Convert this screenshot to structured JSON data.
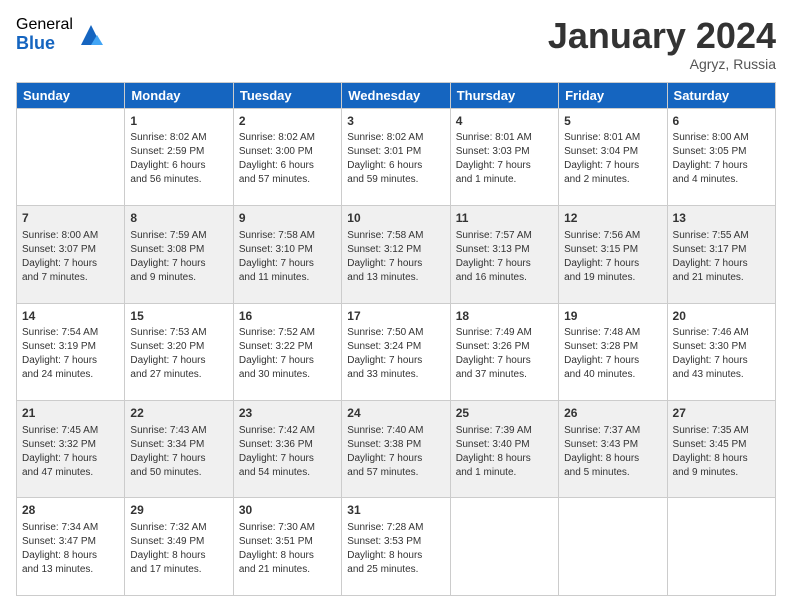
{
  "logo": {
    "general": "General",
    "blue": "Blue"
  },
  "title": "January 2024",
  "subtitle": "Agryz, Russia",
  "days_header": [
    "Sunday",
    "Monday",
    "Tuesday",
    "Wednesday",
    "Thursday",
    "Friday",
    "Saturday"
  ],
  "weeks": [
    [
      {
        "day": "",
        "info": ""
      },
      {
        "day": "1",
        "info": "Sunrise: 8:02 AM\nSunset: 2:59 PM\nDaylight: 6 hours\nand 56 minutes."
      },
      {
        "day": "2",
        "info": "Sunrise: 8:02 AM\nSunset: 3:00 PM\nDaylight: 6 hours\nand 57 minutes."
      },
      {
        "day": "3",
        "info": "Sunrise: 8:02 AM\nSunset: 3:01 PM\nDaylight: 6 hours\nand 59 minutes."
      },
      {
        "day": "4",
        "info": "Sunrise: 8:01 AM\nSunset: 3:03 PM\nDaylight: 7 hours\nand 1 minute."
      },
      {
        "day": "5",
        "info": "Sunrise: 8:01 AM\nSunset: 3:04 PM\nDaylight: 7 hours\nand 2 minutes."
      },
      {
        "day": "6",
        "info": "Sunrise: 8:00 AM\nSunset: 3:05 PM\nDaylight: 7 hours\nand 4 minutes."
      }
    ],
    [
      {
        "day": "7",
        "info": "Sunrise: 8:00 AM\nSunset: 3:07 PM\nDaylight: 7 hours\nand 7 minutes."
      },
      {
        "day": "8",
        "info": "Sunrise: 7:59 AM\nSunset: 3:08 PM\nDaylight: 7 hours\nand 9 minutes."
      },
      {
        "day": "9",
        "info": "Sunrise: 7:58 AM\nSunset: 3:10 PM\nDaylight: 7 hours\nand 11 minutes."
      },
      {
        "day": "10",
        "info": "Sunrise: 7:58 AM\nSunset: 3:12 PM\nDaylight: 7 hours\nand 13 minutes."
      },
      {
        "day": "11",
        "info": "Sunrise: 7:57 AM\nSunset: 3:13 PM\nDaylight: 7 hours\nand 16 minutes."
      },
      {
        "day": "12",
        "info": "Sunrise: 7:56 AM\nSunset: 3:15 PM\nDaylight: 7 hours\nand 19 minutes."
      },
      {
        "day": "13",
        "info": "Sunrise: 7:55 AM\nSunset: 3:17 PM\nDaylight: 7 hours\nand 21 minutes."
      }
    ],
    [
      {
        "day": "14",
        "info": "Sunrise: 7:54 AM\nSunset: 3:19 PM\nDaylight: 7 hours\nand 24 minutes."
      },
      {
        "day": "15",
        "info": "Sunrise: 7:53 AM\nSunset: 3:20 PM\nDaylight: 7 hours\nand 27 minutes."
      },
      {
        "day": "16",
        "info": "Sunrise: 7:52 AM\nSunset: 3:22 PM\nDaylight: 7 hours\nand 30 minutes."
      },
      {
        "day": "17",
        "info": "Sunrise: 7:50 AM\nSunset: 3:24 PM\nDaylight: 7 hours\nand 33 minutes."
      },
      {
        "day": "18",
        "info": "Sunrise: 7:49 AM\nSunset: 3:26 PM\nDaylight: 7 hours\nand 37 minutes."
      },
      {
        "day": "19",
        "info": "Sunrise: 7:48 AM\nSunset: 3:28 PM\nDaylight: 7 hours\nand 40 minutes."
      },
      {
        "day": "20",
        "info": "Sunrise: 7:46 AM\nSunset: 3:30 PM\nDaylight: 7 hours\nand 43 minutes."
      }
    ],
    [
      {
        "day": "21",
        "info": "Sunrise: 7:45 AM\nSunset: 3:32 PM\nDaylight: 7 hours\nand 47 minutes."
      },
      {
        "day": "22",
        "info": "Sunrise: 7:43 AM\nSunset: 3:34 PM\nDaylight: 7 hours\nand 50 minutes."
      },
      {
        "day": "23",
        "info": "Sunrise: 7:42 AM\nSunset: 3:36 PM\nDaylight: 7 hours\nand 54 minutes."
      },
      {
        "day": "24",
        "info": "Sunrise: 7:40 AM\nSunset: 3:38 PM\nDaylight: 7 hours\nand 57 minutes."
      },
      {
        "day": "25",
        "info": "Sunrise: 7:39 AM\nSunset: 3:40 PM\nDaylight: 8 hours\nand 1 minute."
      },
      {
        "day": "26",
        "info": "Sunrise: 7:37 AM\nSunset: 3:43 PM\nDaylight: 8 hours\nand 5 minutes."
      },
      {
        "day": "27",
        "info": "Sunrise: 7:35 AM\nSunset: 3:45 PM\nDaylight: 8 hours\nand 9 minutes."
      }
    ],
    [
      {
        "day": "28",
        "info": "Sunrise: 7:34 AM\nSunset: 3:47 PM\nDaylight: 8 hours\nand 13 minutes."
      },
      {
        "day": "29",
        "info": "Sunrise: 7:32 AM\nSunset: 3:49 PM\nDaylight: 8 hours\nand 17 minutes."
      },
      {
        "day": "30",
        "info": "Sunrise: 7:30 AM\nSunset: 3:51 PM\nDaylight: 8 hours\nand 21 minutes."
      },
      {
        "day": "31",
        "info": "Sunrise: 7:28 AM\nSunset: 3:53 PM\nDaylight: 8 hours\nand 25 minutes."
      },
      {
        "day": "",
        "info": ""
      },
      {
        "day": "",
        "info": ""
      },
      {
        "day": "",
        "info": ""
      }
    ]
  ]
}
